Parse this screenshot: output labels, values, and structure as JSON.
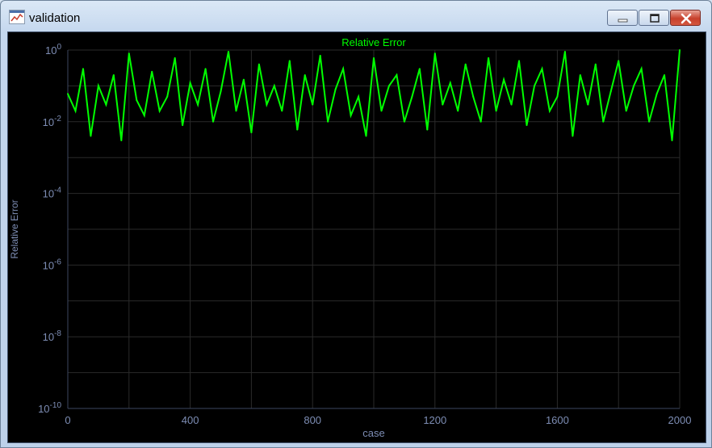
{
  "window": {
    "title": "validation",
    "icon": "chart-app-icon"
  },
  "colors": {
    "series": "#00ff00",
    "axis_text": "#7d8db4",
    "grid": "#2a2a2a",
    "background": "#000000",
    "title_color": "#00ff00"
  },
  "chart_data": {
    "type": "line",
    "title": "Relative Error",
    "xlabel": "case",
    "ylabel": "Relative Error",
    "xlim": [
      0,
      2000
    ],
    "ylim": [
      1e-10,
      1
    ],
    "yscale": "log",
    "x_ticks": [
      "0",
      "400",
      "800",
      "1200",
      "1600",
      "2000"
    ],
    "y_ticks": [
      {
        "base": "10",
        "exp": "0"
      },
      {
        "base": "10",
        "exp": "-2"
      },
      {
        "base": "10",
        "exp": "-4"
      },
      {
        "base": "10",
        "exp": "-6"
      },
      {
        "base": "10",
        "exp": "-8"
      },
      {
        "base": "10",
        "exp": "-10"
      }
    ],
    "grid": true,
    "series": [
      {
        "x": [
          0,
          25,
          50,
          75,
          100,
          125,
          150,
          175,
          200,
          225,
          250,
          275,
          300,
          325,
          350,
          375,
          400,
          425,
          450,
          475,
          500,
          525,
          550,
          575,
          600,
          625,
          650,
          675,
          700,
          725,
          750,
          775,
          800,
          825,
          850,
          875,
          900,
          925,
          950,
          975,
          1000,
          1025,
          1050,
          1075,
          1100,
          1125,
          1150,
          1175,
          1200,
          1225,
          1250,
          1275,
          1300,
          1325,
          1350,
          1375,
          1400,
          1425,
          1450,
          1475,
          1500,
          1525,
          1550,
          1575,
          1600,
          1625,
          1650,
          1675,
          1700,
          1725,
          1750,
          1775,
          1800,
          1825,
          1850,
          1875,
          1900,
          1925,
          1950,
          1975,
          2000
        ],
        "y": [
          0.06,
          0.02,
          0.3,
          0.004,
          0.1,
          0.03,
          0.2,
          0.003,
          0.8,
          0.04,
          0.015,
          0.25,
          0.02,
          0.05,
          0.6,
          0.008,
          0.12,
          0.03,
          0.3,
          0.01,
          0.07,
          0.9,
          0.02,
          0.15,
          0.005,
          0.4,
          0.03,
          0.1,
          0.02,
          0.5,
          0.006,
          0.2,
          0.03,
          0.7,
          0.01,
          0.08,
          0.3,
          0.015,
          0.05,
          0.004,
          0.6,
          0.02,
          0.1,
          0.2,
          0.01,
          0.05,
          0.3,
          0.006,
          0.8,
          0.03,
          0.12,
          0.02,
          0.4,
          0.05,
          0.01,
          0.6,
          0.02,
          0.15,
          0.03,
          0.5,
          0.008,
          0.1,
          0.3,
          0.02,
          0.05,
          0.9,
          0.004,
          0.2,
          0.03,
          0.4,
          0.01,
          0.07,
          0.5,
          0.02,
          0.1,
          0.3,
          0.01,
          0.06,
          0.2,
          0.003,
          1.0
        ]
      }
    ]
  }
}
